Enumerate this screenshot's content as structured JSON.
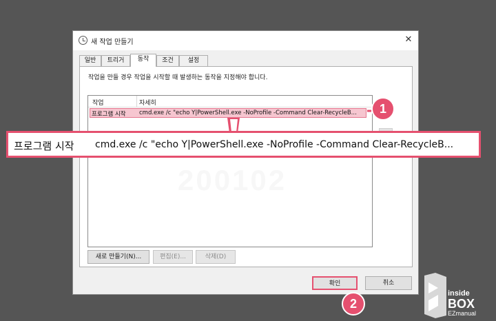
{
  "window": {
    "title": "새 작업 만들기",
    "close_glyph": "✕"
  },
  "tabs": [
    {
      "label": "일반"
    },
    {
      "label": "트리거"
    },
    {
      "label": "동작"
    },
    {
      "label": "조건"
    },
    {
      "label": "설정"
    }
  ],
  "instruction": "작업을 만들 경우 작업을 시작할 때 발생하는 동작을 지정해야 합니다.",
  "actions_table": {
    "columns": [
      "작업",
      "자세히"
    ],
    "rows": [
      {
        "action": "프로그램 시작",
        "details": "cmd.exe /c \"echo Y|PowerShell.exe -NoProfile -Command Clear-RecycleB..."
      }
    ]
  },
  "buttons": {
    "new": "새로 만들기(N)...",
    "edit": "편집(E)...",
    "delete": "삭제(D)",
    "ok": "확인",
    "cancel": "취소"
  },
  "zoom_callout": {
    "action": "프로그램 시작",
    "details": "cmd.exe /c \"echo Y|PowerShell.exe -NoProfile -Command Clear-RecycleB..."
  },
  "annotations": {
    "badge1": "1",
    "badge2": "2",
    "watermark": "200102"
  },
  "logo": {
    "line1": "inside",
    "line2": "BOX",
    "line3": "EZmanual"
  },
  "colors": {
    "highlight": "#e5506f",
    "selection": "#f6c6d0",
    "background": "#555555"
  }
}
